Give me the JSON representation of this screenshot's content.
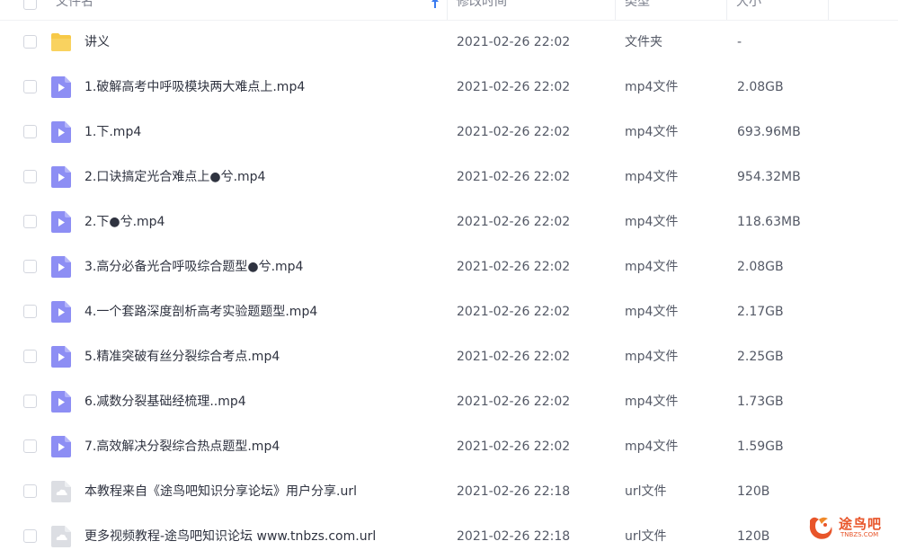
{
  "header": {
    "name_label": "文件名",
    "modified_label": "修改时间",
    "type_label": "类型",
    "size_label": "大小"
  },
  "rows": [
    {
      "name": "讲义",
      "date": "2021-02-26 22:02",
      "type": "文件夹",
      "size": "-",
      "icon": "folder-icon"
    },
    {
      "name": "1.破解高考中呼吸模块两大难点上.mp4",
      "date": "2021-02-26 22:02",
      "type": "mp4文件",
      "size": "2.08GB",
      "icon": "video-file-icon"
    },
    {
      "name": "1.下.mp4",
      "date": "2021-02-26 22:02",
      "type": "mp4文件",
      "size": "693.96MB",
      "icon": "video-file-icon"
    },
    {
      "name": "2.口诀搞定光合难点上●兮.mp4",
      "date": "2021-02-26 22:02",
      "type": "mp4文件",
      "size": "954.32MB",
      "icon": "video-file-icon"
    },
    {
      "name": "2.下●兮.mp4",
      "date": "2021-02-26 22:02",
      "type": "mp4文件",
      "size": "118.63MB",
      "icon": "video-file-icon"
    },
    {
      "name": "3.高分必备光合呼吸综合题型●兮.mp4",
      "date": "2021-02-26 22:02",
      "type": "mp4文件",
      "size": "2.08GB",
      "icon": "video-file-icon"
    },
    {
      "name": "4.一个套路深度剖析高考实验题题型.mp4",
      "date": "2021-02-26 22:02",
      "type": "mp4文件",
      "size": "2.17GB",
      "icon": "video-file-icon"
    },
    {
      "name": "5.精准突破有丝分裂综合考点.mp4",
      "date": "2021-02-26 22:02",
      "type": "mp4文件",
      "size": "2.25GB",
      "icon": "video-file-icon"
    },
    {
      "name": "6.减数分裂基础经梳理..mp4",
      "date": "2021-02-26 22:02",
      "type": "mp4文件",
      "size": "1.73GB",
      "icon": "video-file-icon"
    },
    {
      "name": "7.高效解决分裂综合热点题型.mp4",
      "date": "2021-02-26 22:02",
      "type": "mp4文件",
      "size": "1.59GB",
      "icon": "video-file-icon"
    },
    {
      "name": "本教程来自《途鸟吧知识分享论坛》用户分享.url",
      "date": "2021-02-26 22:18",
      "type": "url文件",
      "size": "120B",
      "icon": "url-file-icon"
    },
    {
      "name": "更多视频教程-途鸟吧知识论坛 www.tnbzs.com.url",
      "date": "2021-02-26 22:18",
      "type": "url文件",
      "size": "120B",
      "icon": "url-file-icon"
    }
  ],
  "watermark": {
    "text": "途鸟吧",
    "sub": "TNBZS.COM"
  },
  "colors": {
    "folder": "#f7c948",
    "video": "#8d8ef4",
    "url": "#dcdee3"
  }
}
